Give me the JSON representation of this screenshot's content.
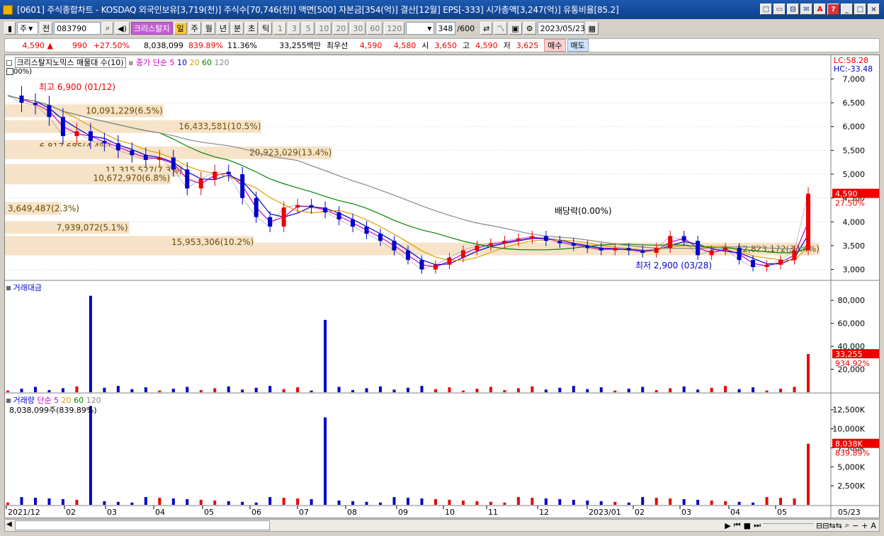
{
  "window": {
    "title": "[0601] 주식종합차트 - KOSDAQ 외국인보유[3,719(천)] 주식수[70,746(천)] 액면[500] 자본금[354(억)] 결산[12월] EPS[-333] 시가총액[3,247(억)] 유통비율[85.2]",
    "buttons": [
      "□",
      "▭",
      "⊟",
      "✉",
      "A",
      "?",
      "_",
      "□",
      "×"
    ]
  },
  "toolbar": {
    "period_select": "주",
    "prev_label": "전",
    "code": "083790",
    "stock_name": "크리스탈지",
    "period_tabs": [
      "일",
      "주",
      "월",
      "년",
      "분",
      "초",
      "틱"
    ],
    "active_period": "일",
    "interval_buttons": [
      "1",
      "3",
      "5",
      "10",
      "20",
      "30",
      "60",
      "120"
    ],
    "count": "348",
    "count_max": "/600",
    "date": "2023/05/23"
  },
  "quote": {
    "price": "4,590",
    "arrow": "▲",
    "change": "990",
    "change_pct": "+27.50%",
    "volume": "8,038,099",
    "volume_ratio": "839.89%",
    "turnover": "11.36%",
    "amount": "33,255백만",
    "best_label": "최우선",
    "best_ask": "4,590",
    "best_bid": "4,580",
    "open_label": "시",
    "open": "3,650",
    "high_label": "고",
    "high": "4,590",
    "low_label": "저",
    "low": "3,625",
    "buy_label": "매수",
    "sell_label": "매도"
  },
  "panels": {
    "price": {
      "title": "크리스탈지노믹스 매물대 수(10)",
      "ma_label": "종가 단순",
      "ma_periods": [
        "5",
        "10",
        "20",
        "60",
        "120"
      ],
      "ma_colors": [
        "#cc00cc",
        "#0000cc",
        "#e0a000",
        "#008800",
        "#888888"
      ],
      "mini_label": "00%)",
      "lc": "LC:58.28",
      "hc": "HC:-33.48",
      "high_annot": "최고 6,900 (01/12)",
      "low_annot": "최저 2,900 (03/28)",
      "div_annot": "배당락(0.00%)",
      "current_price": "4,590",
      "current_pct": "27.50%",
      "y_ticks": [
        "7,000",
        "6,500",
        "6,000",
        "5,500",
        "5,000",
        "4,500",
        "4,000",
        "3,500",
        "3,000"
      ],
      "volume_profile": [
        "10,091,229(6.5%)",
        "16,433,581(10.5%)",
        "6,817,685(4.4%)",
        "20,923,029(13.4%)",
        "11,315,527(7.3%)",
        "10,672,970(6.8%)",
        "3,649,487(2.3%)",
        "7,939,072(5.1%)",
        "52,823,172(33.4%)",
        "15,953,306(10.2%)"
      ]
    },
    "amount": {
      "title": "거래대금",
      "y_ticks": [
        "80,000",
        "60,000",
        "40,000",
        "20,000"
      ],
      "current": "33,255",
      "current_pct": "934.92%"
    },
    "volume": {
      "title": "거래량",
      "ma_label": "단순",
      "ma_periods": [
        "5",
        "20",
        "60",
        "120"
      ],
      "current_text": "8,038,099주(839.89%)",
      "y_ticks": [
        "12,500K",
        "10,000K",
        "7,500K",
        "5,000K",
        "2,500K"
      ],
      "current": "8,038K",
      "current_pct": "839.89%"
    }
  },
  "x_axis": [
    "2021/12",
    "02",
    "03",
    "04",
    "05",
    "06",
    "07",
    "08",
    "09",
    "10",
    "11",
    "12",
    "2023/01",
    "02",
    "03",
    "04",
    "05"
  ],
  "x_axis_right": "05/23",
  "chart_data": {
    "type": "candlestick",
    "price_range": [
      2800,
      7200
    ],
    "series_close_weekly": [
      6650,
      6500,
      6450,
      6200,
      5800,
      5900,
      5700,
      5650,
      5500,
      5400,
      5300,
      5350,
      5100,
      4700,
      4900,
      5050,
      5000,
      4500,
      4100,
      3900,
      4300,
      4350,
      4300,
      4200,
      4050,
      3900,
      3750,
      3600,
      3400,
      3200,
      3000,
      3100,
      3250,
      3400,
      3500,
      3550,
      3600,
      3650,
      3700,
      3600,
      3550,
      3500,
      3450,
      3400,
      3450,
      3400,
      3350,
      3450,
      3700,
      3600,
      3300,
      3400,
      3450,
      3200,
      3050,
      3100,
      3200,
      3400,
      4590
    ],
    "amount_peaks_millions": [
      84000,
      63000,
      33255
    ],
    "volume_peaks_k": [
      13000,
      11500,
      8038
    ]
  }
}
